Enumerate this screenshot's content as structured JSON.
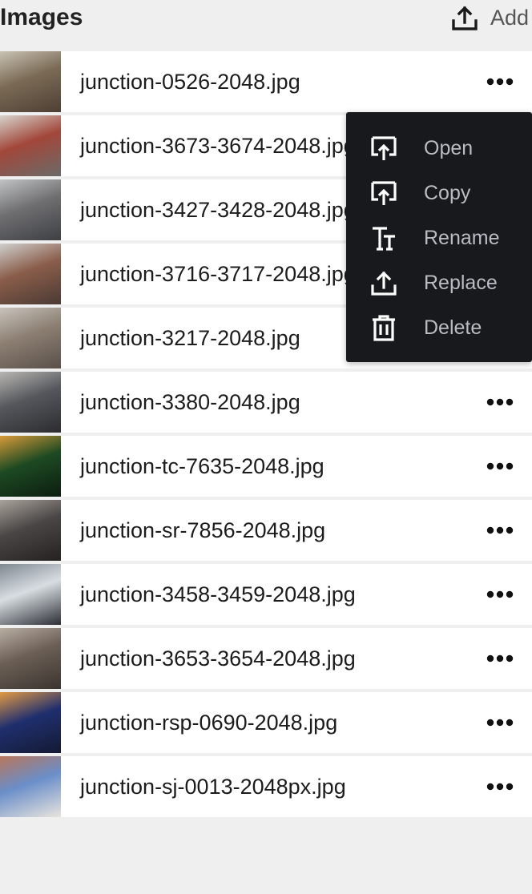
{
  "header": {
    "title": "Images",
    "add_label": "Add",
    "add_icon": "upload-icon"
  },
  "files": [
    {
      "name": "junction-0526-2048.jpg",
      "colors": [
        "#7a6a55",
        "#c9c2b3",
        "#4e3f34"
      ]
    },
    {
      "name": "junction-3673-3674-2048.jpg",
      "colors": [
        "#a2473a",
        "#d7d3cc",
        "#6b6a68"
      ]
    },
    {
      "name": "junction-3427-3428-2048.jpg",
      "colors": [
        "#6f6f71",
        "#c2c3c5",
        "#3e3f44"
      ]
    },
    {
      "name": "junction-3716-3717-2048.jpg",
      "colors": [
        "#8a5d4a",
        "#cfcfcd",
        "#4a3b34"
      ]
    },
    {
      "name": "junction-3217-2048.jpg",
      "colors": [
        "#8c7f72",
        "#c8c3bc",
        "#5a504a"
      ]
    },
    {
      "name": "junction-3380-2048.jpg",
      "colors": [
        "#55575c",
        "#b8b6b2",
        "#2c2c30"
      ]
    },
    {
      "name": "junction-tc-7635-2048.jpg",
      "colors": [
        "#1d4a22",
        "#d89a3a",
        "#0c1d10"
      ]
    },
    {
      "name": "junction-sr-7856-2048.jpg",
      "colors": [
        "#4a4645",
        "#a9a39c",
        "#242120"
      ]
    },
    {
      "name": "junction-3458-3459-2048.jpg",
      "colors": [
        "#d8dde2",
        "#7f8890",
        "#2b2f35"
      ]
    },
    {
      "name": "junction-3653-3654-2048.jpg",
      "colors": [
        "#6b5f55",
        "#b9aea2",
        "#3b3430"
      ]
    },
    {
      "name": "junction-rsp-0690-2048.jpg",
      "colors": [
        "#1f2f6e",
        "#e29a45",
        "#141a33"
      ]
    },
    {
      "name": "junction-sj-0013-2048px.jpg",
      "colors": [
        "#6a8ec9",
        "#b9765a",
        "#e8e4dd"
      ]
    }
  ],
  "row_actions": {
    "icon": "more-horizontal-icon"
  },
  "context_menu": {
    "items": [
      {
        "label": "Open",
        "icon": "open-icon"
      },
      {
        "label": "Copy",
        "icon": "copy-icon"
      },
      {
        "label": "Rename",
        "icon": "text-icon"
      },
      {
        "label": "Replace",
        "icon": "upload-icon"
      },
      {
        "label": "Delete",
        "icon": "trash-icon"
      }
    ]
  }
}
